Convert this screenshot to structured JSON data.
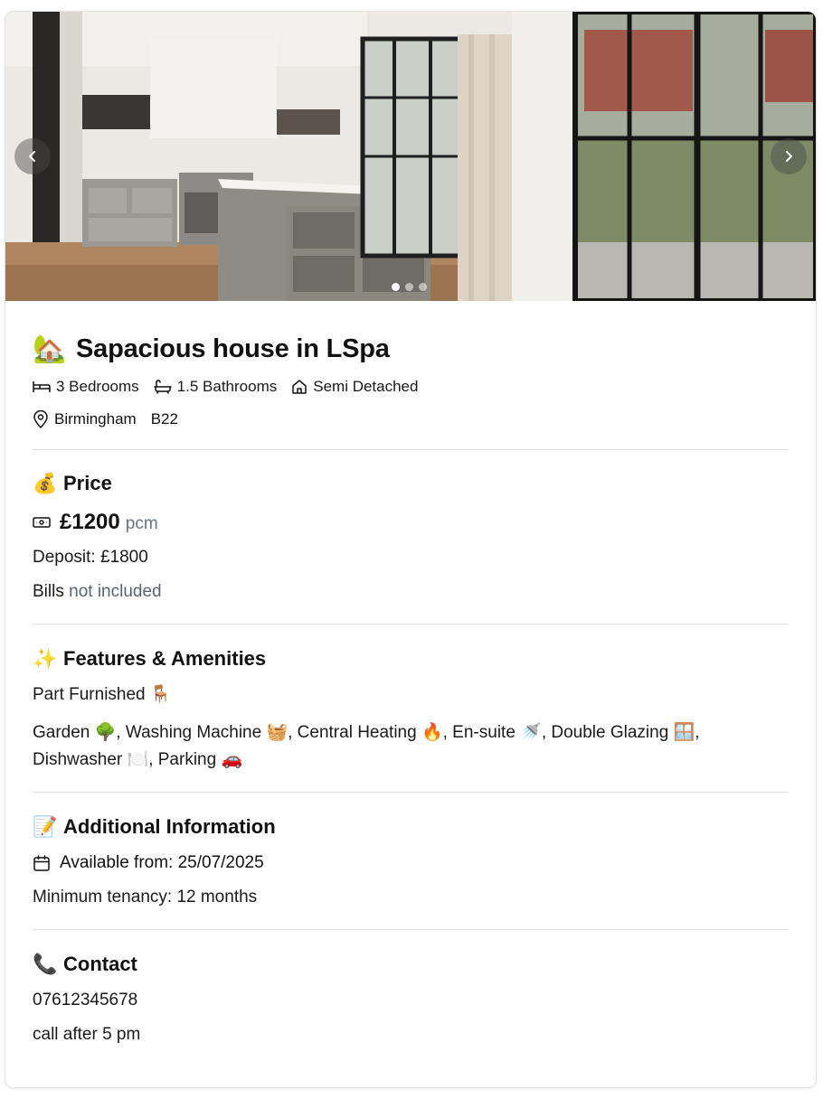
{
  "carousel": {
    "prev_icon": "chevron-left-icon",
    "next_icon": "chevron-right-icon",
    "slide_count": 3,
    "active_slide": 1
  },
  "listing": {
    "title_emoji": "🏡",
    "title": "Sapacious house in LSpa",
    "bedrooms": "3 Bedrooms",
    "bathrooms": "1.5 Bathrooms",
    "property_type": "Semi Detached",
    "city": "Birmingham",
    "postcode": "B22"
  },
  "price": {
    "heading_emoji": "💰",
    "heading": "Price",
    "amount": "£1200",
    "period": "pcm",
    "deposit": "Deposit: £1800",
    "bills_prefix": "Bills",
    "bills_status": "not included"
  },
  "features": {
    "heading_emoji": "✨",
    "heading": "Features & Amenities",
    "furnishing": "Part Furnished 🪑",
    "amenities_line1": "Garden 🌳, Washing Machine 🧺, Central Heating 🔥, En-suite 🚿, Double Glazing 🪟,",
    "amenities_line2": "Dishwasher 🍽️, Parking 🚗"
  },
  "additional": {
    "heading_emoji": "📝",
    "heading": "Additional Information",
    "available_from": "Available from: 25/07/2025",
    "min_tenancy": "Minimum tenancy: 12 months"
  },
  "contact": {
    "heading_emoji": "📞",
    "heading": "Contact",
    "phone": "07612345678",
    "note": "call after 5 pm"
  }
}
